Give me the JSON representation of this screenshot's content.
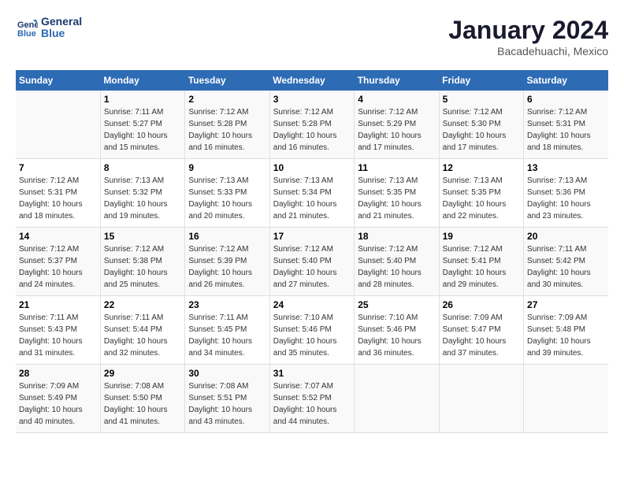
{
  "logo": {
    "line1": "General",
    "line2": "Blue"
  },
  "title": "January 2024",
  "subtitle": "Bacadehuachi, Mexico",
  "days_of_week": [
    "Sunday",
    "Monday",
    "Tuesday",
    "Wednesday",
    "Thursday",
    "Friday",
    "Saturday"
  ],
  "weeks": [
    [
      {
        "date": "",
        "info": ""
      },
      {
        "date": "1",
        "info": "Sunrise: 7:11 AM\nSunset: 5:27 PM\nDaylight: 10 hours\nand 15 minutes."
      },
      {
        "date": "2",
        "info": "Sunrise: 7:12 AM\nSunset: 5:28 PM\nDaylight: 10 hours\nand 16 minutes."
      },
      {
        "date": "3",
        "info": "Sunrise: 7:12 AM\nSunset: 5:28 PM\nDaylight: 10 hours\nand 16 minutes."
      },
      {
        "date": "4",
        "info": "Sunrise: 7:12 AM\nSunset: 5:29 PM\nDaylight: 10 hours\nand 17 minutes."
      },
      {
        "date": "5",
        "info": "Sunrise: 7:12 AM\nSunset: 5:30 PM\nDaylight: 10 hours\nand 17 minutes."
      },
      {
        "date": "6",
        "info": "Sunrise: 7:12 AM\nSunset: 5:31 PM\nDaylight: 10 hours\nand 18 minutes."
      }
    ],
    [
      {
        "date": "7",
        "info": "Sunrise: 7:12 AM\nSunset: 5:31 PM\nDaylight: 10 hours\nand 18 minutes."
      },
      {
        "date": "8",
        "info": "Sunrise: 7:13 AM\nSunset: 5:32 PM\nDaylight: 10 hours\nand 19 minutes."
      },
      {
        "date": "9",
        "info": "Sunrise: 7:13 AM\nSunset: 5:33 PM\nDaylight: 10 hours\nand 20 minutes."
      },
      {
        "date": "10",
        "info": "Sunrise: 7:13 AM\nSunset: 5:34 PM\nDaylight: 10 hours\nand 21 minutes."
      },
      {
        "date": "11",
        "info": "Sunrise: 7:13 AM\nSunset: 5:35 PM\nDaylight: 10 hours\nand 21 minutes."
      },
      {
        "date": "12",
        "info": "Sunrise: 7:13 AM\nSunset: 5:35 PM\nDaylight: 10 hours\nand 22 minutes."
      },
      {
        "date": "13",
        "info": "Sunrise: 7:13 AM\nSunset: 5:36 PM\nDaylight: 10 hours\nand 23 minutes."
      }
    ],
    [
      {
        "date": "14",
        "info": "Sunrise: 7:12 AM\nSunset: 5:37 PM\nDaylight: 10 hours\nand 24 minutes."
      },
      {
        "date": "15",
        "info": "Sunrise: 7:12 AM\nSunset: 5:38 PM\nDaylight: 10 hours\nand 25 minutes."
      },
      {
        "date": "16",
        "info": "Sunrise: 7:12 AM\nSunset: 5:39 PM\nDaylight: 10 hours\nand 26 minutes."
      },
      {
        "date": "17",
        "info": "Sunrise: 7:12 AM\nSunset: 5:40 PM\nDaylight: 10 hours\nand 27 minutes."
      },
      {
        "date": "18",
        "info": "Sunrise: 7:12 AM\nSunset: 5:40 PM\nDaylight: 10 hours\nand 28 minutes."
      },
      {
        "date": "19",
        "info": "Sunrise: 7:12 AM\nSunset: 5:41 PM\nDaylight: 10 hours\nand 29 minutes."
      },
      {
        "date": "20",
        "info": "Sunrise: 7:11 AM\nSunset: 5:42 PM\nDaylight: 10 hours\nand 30 minutes."
      }
    ],
    [
      {
        "date": "21",
        "info": "Sunrise: 7:11 AM\nSunset: 5:43 PM\nDaylight: 10 hours\nand 31 minutes."
      },
      {
        "date": "22",
        "info": "Sunrise: 7:11 AM\nSunset: 5:44 PM\nDaylight: 10 hours\nand 32 minutes."
      },
      {
        "date": "23",
        "info": "Sunrise: 7:11 AM\nSunset: 5:45 PM\nDaylight: 10 hours\nand 34 minutes."
      },
      {
        "date": "24",
        "info": "Sunrise: 7:10 AM\nSunset: 5:46 PM\nDaylight: 10 hours\nand 35 minutes."
      },
      {
        "date": "25",
        "info": "Sunrise: 7:10 AM\nSunset: 5:46 PM\nDaylight: 10 hours\nand 36 minutes."
      },
      {
        "date": "26",
        "info": "Sunrise: 7:09 AM\nSunset: 5:47 PM\nDaylight: 10 hours\nand 37 minutes."
      },
      {
        "date": "27",
        "info": "Sunrise: 7:09 AM\nSunset: 5:48 PM\nDaylight: 10 hours\nand 39 minutes."
      }
    ],
    [
      {
        "date": "28",
        "info": "Sunrise: 7:09 AM\nSunset: 5:49 PM\nDaylight: 10 hours\nand 40 minutes."
      },
      {
        "date": "29",
        "info": "Sunrise: 7:08 AM\nSunset: 5:50 PM\nDaylight: 10 hours\nand 41 minutes."
      },
      {
        "date": "30",
        "info": "Sunrise: 7:08 AM\nSunset: 5:51 PM\nDaylight: 10 hours\nand 43 minutes."
      },
      {
        "date": "31",
        "info": "Sunrise: 7:07 AM\nSunset: 5:52 PM\nDaylight: 10 hours\nand 44 minutes."
      },
      {
        "date": "",
        "info": ""
      },
      {
        "date": "",
        "info": ""
      },
      {
        "date": "",
        "info": ""
      }
    ]
  ]
}
